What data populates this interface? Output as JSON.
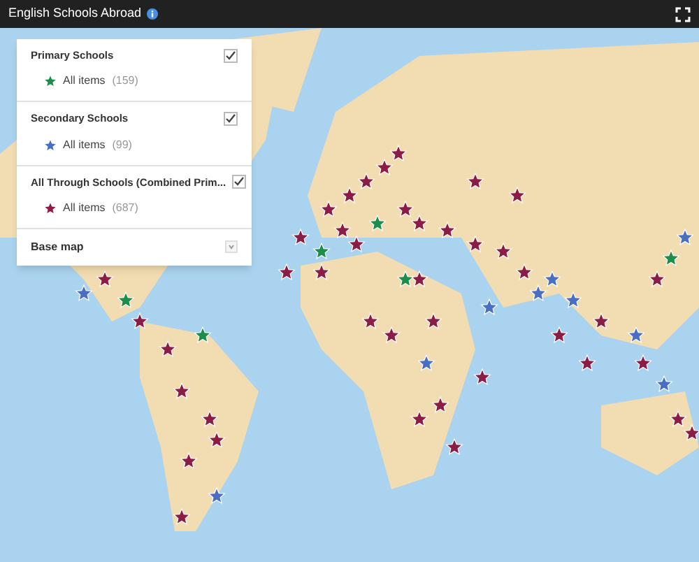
{
  "window": {
    "title": "English Schools Abroad"
  },
  "legend": {
    "layers": [
      {
        "title": "Primary Schools",
        "checked": true,
        "items": [
          {
            "label": "All items",
            "count": "(159)",
            "color": "#1e8c4a"
          }
        ]
      },
      {
        "title": "Secondary Schools",
        "checked": true,
        "items": [
          {
            "label": "All items",
            "count": "(99)",
            "color": "#4a6fc2"
          }
        ]
      },
      {
        "title": "All Through Schools (Combined Prim...",
        "checked": true,
        "items": [
          {
            "label": "All items",
            "count": "(687)",
            "color": "#8a1c45"
          }
        ]
      }
    ],
    "base_map": {
      "label": "Base map",
      "expanded": false
    }
  }
}
